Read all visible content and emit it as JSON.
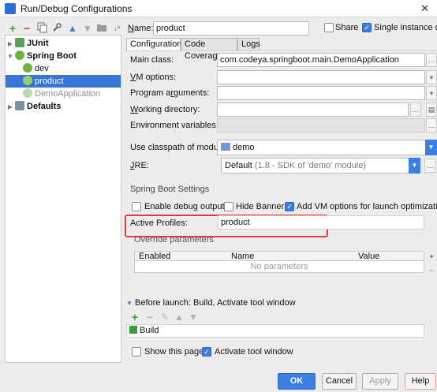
{
  "window": {
    "title": "Run/Debug Configurations"
  },
  "left_toolbar": {
    "add": "+",
    "remove": "−"
  },
  "tree": {
    "items": [
      {
        "label": "JUnit",
        "level": 0,
        "bold": true
      },
      {
        "label": "Spring Boot",
        "level": 0,
        "bold": true
      },
      {
        "label": "dev",
        "level": 1
      },
      {
        "label": "product",
        "level": 1,
        "selected": true
      },
      {
        "label": "DemoApplication",
        "level": 1,
        "muted": true
      },
      {
        "label": "Defaults",
        "level": 0,
        "bold": true
      }
    ]
  },
  "header": {
    "name_label": "Name:",
    "name_value": "product",
    "share_label": "Share",
    "share_checked": false,
    "single_instance_label": "Single instance onl",
    "single_instance_checked": true
  },
  "tabs": [
    "Configuration",
    "Code Coverage",
    "Logs"
  ],
  "form": {
    "main_class_label": "Main class:",
    "main_class_value": "com.codeya.springboot.main.DemoApplication",
    "vm_options_label": "VM options:",
    "program_arguments_label": "Program arguments:",
    "working_directory_label": "Working directory:",
    "environment_variables_label": "Environment variables:",
    "classpath_label": "Use classpath of module:",
    "classpath_value": "demo",
    "jre_label": "JRE:",
    "jre_value": "Default",
    "jre_hint": "(1.8 - SDK of 'demo' module)"
  },
  "spring_boot_settings": {
    "title": "Spring Boot Settings",
    "enable_debug_output": "Enable debug output",
    "hide_banner": "Hide Banner",
    "add_vm_options": "Add VM options for launch optimization",
    "active_profiles_label": "Active Profiles:",
    "active_profiles_value": "product",
    "override_parameters": "Override parameters"
  },
  "params_table": {
    "columns": [
      "Enabled",
      "Name",
      "Value"
    ],
    "empty_text": "No parameters"
  },
  "before_launch": {
    "title": "Before launch: Build, Activate tool window",
    "items": [
      "Build"
    ],
    "show_this_page": "Show this page",
    "activate_tool_window": "Activate tool window"
  },
  "buttons": {
    "ok": "OK",
    "cancel": "Cancel",
    "apply": "Apply",
    "help": "Help"
  },
  "colors": {
    "accent": "#3b7de0",
    "selection": "#3875d7",
    "highlight": "#e53b3b"
  }
}
